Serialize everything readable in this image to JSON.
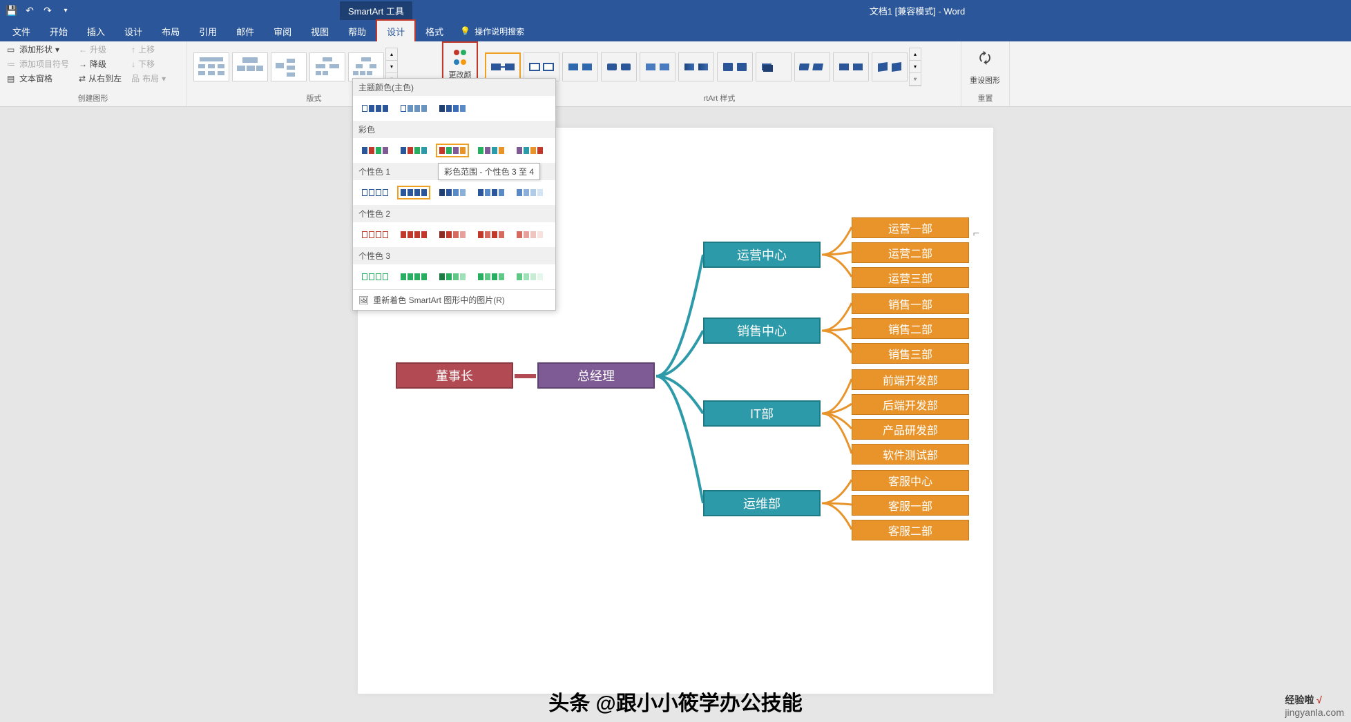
{
  "title_bar": {
    "context_tab": "SmartArt 工具",
    "document_title": "文档1 [兼容模式] - Word"
  },
  "tabs": {
    "file": "文件",
    "home": "开始",
    "insert": "插入",
    "design_main": "设计",
    "layout": "布局",
    "references": "引用",
    "mailings": "邮件",
    "review": "审阅",
    "view": "视图",
    "help": "帮助",
    "sa_design": "设计",
    "sa_format": "格式",
    "tell_me": "操作说明搜索"
  },
  "ribbon": {
    "create": {
      "label": "创建图形",
      "add_shape": "添加形状",
      "promote": "升级",
      "move_up": "上移",
      "add_bullet": "添加项目符号",
      "demote": "降级",
      "move_down": "下移",
      "text_pane": "文本窗格",
      "rtl": "从右到左",
      "layout_btn": "布局"
    },
    "layouts": {
      "label": "版式"
    },
    "change_color": "更改颜色",
    "styles_label": "rtArt 样式",
    "reset": {
      "button": "重设图形",
      "label": "重置"
    }
  },
  "color_popup": {
    "theme": "主题颜色(主色)",
    "colorful": "彩色",
    "accent1": "个性色 1",
    "accent2": "个性色 2",
    "accent3": "个性色 3",
    "recolor": "重新着色 SmartArt 图形中的图片(R)",
    "tooltip": "彩色范围 - 个性色 3 至 4"
  },
  "smartart": {
    "level1": "董事长",
    "level2": "总经理",
    "centers": [
      "运营中心",
      "销售中心",
      "IT部",
      "运维部"
    ],
    "leaves": [
      [
        "运营一部",
        "运营二部",
        "运营三部"
      ],
      [
        "销售一部",
        "销售二部",
        "销售三部"
      ],
      [
        "前端开发部",
        "后端开发部",
        "产品研发部",
        "软件测试部"
      ],
      [
        "客服中心",
        "客服一部",
        "客服二部"
      ]
    ]
  },
  "watermark": "头条 @跟小小筱学办公技能",
  "logo": {
    "t1": "经验啦",
    "t2": "jingyanla.com"
  }
}
